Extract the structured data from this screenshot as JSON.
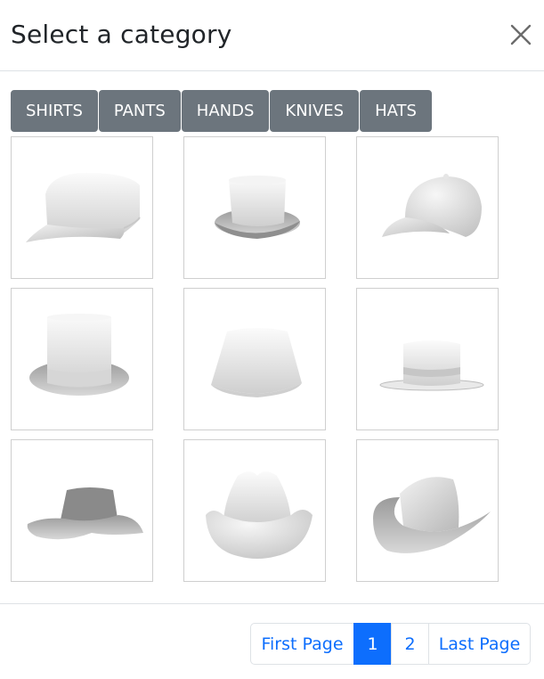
{
  "dialog": {
    "title": "Select a category",
    "close_icon": "close-icon"
  },
  "tabs": [
    {
      "label": "SHIRTS"
    },
    {
      "label": "PANTS"
    },
    {
      "label": "HANDS"
    },
    {
      "label": "KNIVES"
    },
    {
      "label": "HATS"
    }
  ],
  "items": [
    {
      "name": "military-cap"
    },
    {
      "name": "short-top-hat"
    },
    {
      "name": "baseball-cap"
    },
    {
      "name": "top-hat"
    },
    {
      "name": "bucket-hat"
    },
    {
      "name": "flat-brim-hat"
    },
    {
      "name": "floppy-hat"
    },
    {
      "name": "cowboy-hat-front"
    },
    {
      "name": "cowboy-hat-side"
    }
  ],
  "pagination": {
    "first_label": "First Page",
    "pages": [
      "1",
      "2"
    ],
    "current": "1",
    "last_label": "Last Page"
  },
  "colors": {
    "tab_bg": "#6c757d",
    "active_page": "#0d6efd",
    "link": "#0d6efd"
  }
}
